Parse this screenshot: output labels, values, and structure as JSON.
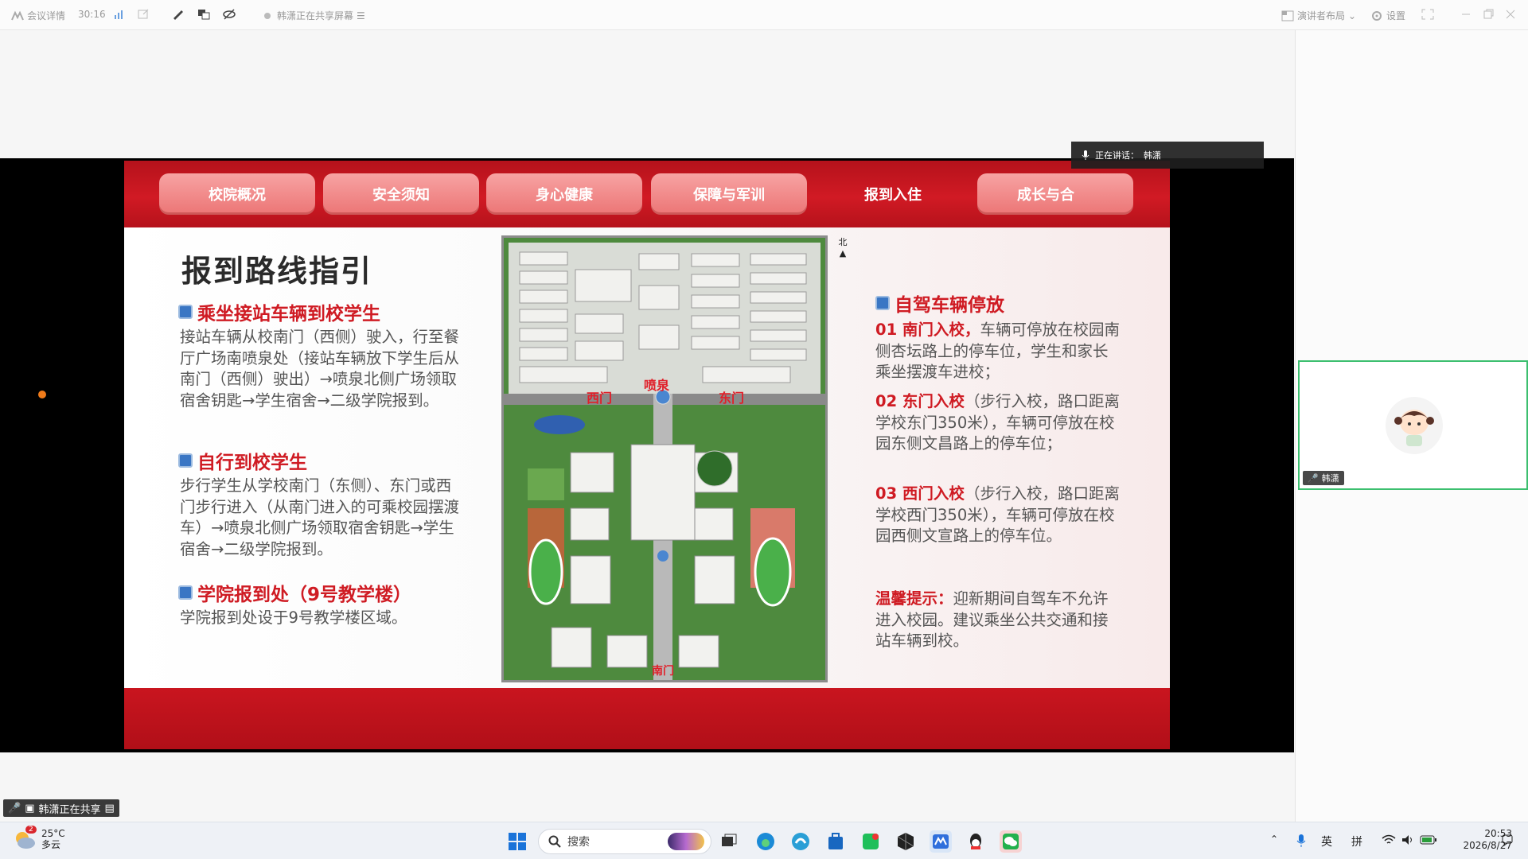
{
  "topbar": {
    "meeting_info": "会议详情",
    "duration": "30:16",
    "sharing_status": "韩潇正在共享屏幕",
    "layout_label": "演讲者布局",
    "settings_label": "设置"
  },
  "slide": {
    "nav_tabs": [
      "校院概况",
      "安全须知",
      "身心健康",
      "保障与军训",
      "报到入住",
      "成长与合"
    ],
    "active_tab": "报到入住",
    "title": "报到路线指引",
    "left_sections": [
      {
        "heading": "乘坐接站车辆到校学生",
        "body": "接站车辆从校南门（西侧）驶入，行至餐厅广场南喷泉处（接站车辆放下学生后从南门（西侧）驶出）→喷泉北侧广场领取宿舍钥匙→学生宿舍→二级学院报到。"
      },
      {
        "heading": "自行到校学生",
        "body": "步行学生从学校南门（东侧）、东门或西门步行进入（从南门进入的可乘校园摆渡车）→喷泉北侧广场领取宿舍钥匙→学生宿舍→二级学院报到。"
      },
      {
        "heading": "学院报到处（9号教学楼）",
        "body": "学院报到处设于9号教学楼区域。"
      }
    ],
    "map_labels": {
      "west_gate": "西门",
      "fountain": "喷泉",
      "east_gate": "东门",
      "south_gate": "南门",
      "north": "北"
    },
    "right_heading": "自驾车辆停放",
    "right_items": [
      {
        "lead": "01 南门入校，",
        "body": "车辆可停放在校园南侧杏坛路上的停车位，学生和家长乘坐摆渡车进校；"
      },
      {
        "lead": "02 东门入校",
        "body": "（步行入校，路口距离学校东门350米），车辆可停放在校园东侧文昌路上的停车位；"
      },
      {
        "lead": "03 西门入校",
        "body": "（步行入校，路口距离学校西门350米），车辆可停放在校园西侧文宣路上的停车位。"
      }
    ],
    "tip_lead": "温馨提示：",
    "tip_body": "迎新期间自驾车不允许进入校园。建议乘坐公共交通和接站车辆到校。"
  },
  "speaking": {
    "label": "正在讲话：",
    "name": "韩潇"
  },
  "participant": {
    "name": "韩潇"
  },
  "share_badge": "韩潇正在共享",
  "taskbar": {
    "weather_temp": "25°C",
    "weather_desc": "多云",
    "weather_badge": "2",
    "search_placeholder": "搜索",
    "ime_lang": "英",
    "ime_mode": "拼",
    "time": "20:53",
    "date": "2026/8/27"
  },
  "colors": {
    "accent_red": "#cf1b23",
    "video_border": "#3cbf6f"
  }
}
